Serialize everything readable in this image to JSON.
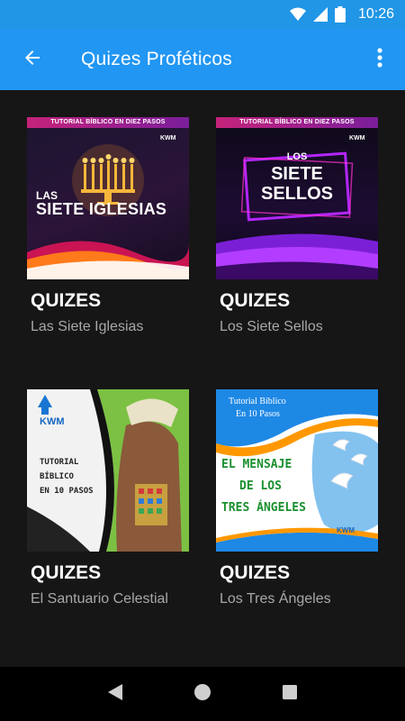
{
  "status_bar": {
    "time": "10:26"
  },
  "app_bar": {
    "title": "Quizes Proféticos"
  },
  "cards": [
    {
      "title": "QUIZES",
      "subtitle": "Las Siete Iglesias",
      "thumb": {
        "banner": "TUTORIAL BÍBLICO EN DIEZ PASOS",
        "line1": "LAS",
        "line2": "SIETE IGLESIAS",
        "logo": "KWM"
      }
    },
    {
      "title": "QUIZES",
      "subtitle": "Los Siete Sellos",
      "thumb": {
        "banner": "TUTORIAL BÍBLICO EN DIEZ PASOS",
        "line1": "LOS",
        "line2": "SIETE",
        "line3": "SELLOS",
        "logo": "KWM"
      }
    },
    {
      "title": "QUIZES",
      "subtitle": "El Santuario Celestial",
      "thumb": {
        "logo": "KWM",
        "line1": "TUTORIAL",
        "line2": "BÍBLICO",
        "line3": "EN 10 PASOS"
      }
    },
    {
      "title": "QUIZES",
      "subtitle": "Los Tres Ángeles",
      "thumb": {
        "top1": "Tutorial Bíblico",
        "top2": "En 10 Pasos",
        "line1": "EL MENSAJE",
        "line2": "DE LOS",
        "line3": "TRES ÁNGELES",
        "logo": "KWM"
      }
    }
  ],
  "colors": {
    "appbar": "#2196f3",
    "statusbar": "#2196e6",
    "background": "#161616"
  },
  "icons": {
    "back": "arrow-left-icon",
    "menu": "more-vert-icon",
    "nav_back": "triangle-back-icon",
    "nav_home": "circle-home-icon",
    "nav_recents": "square-recents-icon"
  }
}
